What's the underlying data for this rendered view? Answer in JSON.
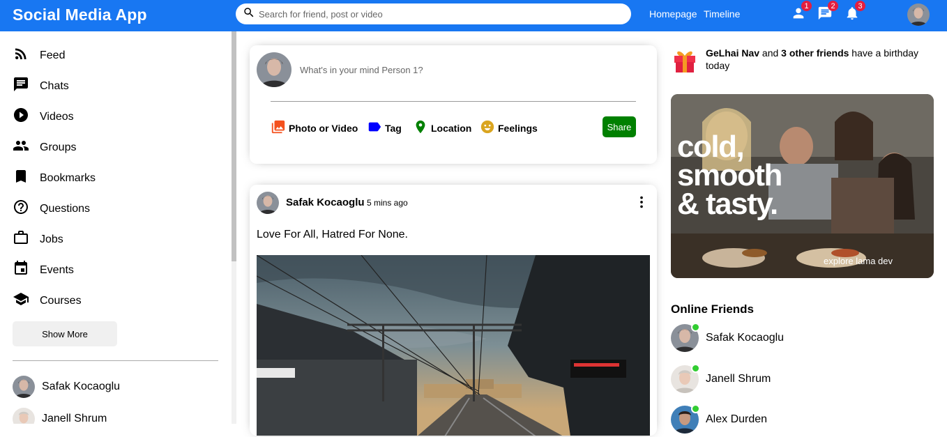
{
  "topbar": {
    "logo": "Social Media App",
    "search_placeholder": "Search for friend, post or video",
    "links": [
      "Homepage",
      "Timeline"
    ],
    "badges": {
      "person": "1",
      "chat": "2",
      "notifications": "3"
    },
    "color": "#1877f2"
  },
  "sidebar": {
    "items": [
      {
        "label": "Feed",
        "icon": "rss-feed-icon"
      },
      {
        "label": "Chats",
        "icon": "chat-icon"
      },
      {
        "label": "Videos",
        "icon": "play-circle-icon"
      },
      {
        "label": "Groups",
        "icon": "group-icon"
      },
      {
        "label": "Bookmarks",
        "icon": "bookmark-icon"
      },
      {
        "label": "Questions",
        "icon": "help-circle-icon"
      },
      {
        "label": "Jobs",
        "icon": "briefcase-icon"
      },
      {
        "label": "Events",
        "icon": "calendar-icon"
      },
      {
        "label": "Courses",
        "icon": "school-icon"
      }
    ],
    "show_more": "Show More",
    "friends": [
      "Safak Kocaoglu",
      "Janell Shrum"
    ]
  },
  "share": {
    "placeholder": "What's in your mind Person 1?",
    "options": [
      {
        "label": "Photo or Video",
        "icon": "photo-library-icon",
        "color": "#f4511e"
      },
      {
        "label": "Tag",
        "icon": "label-icon",
        "color": "#0000ff"
      },
      {
        "label": "Location",
        "icon": "location-pin-icon",
        "color": "#008000"
      },
      {
        "label": "Feelings",
        "icon": "emoji-icon",
        "color": "#daa520"
      }
    ],
    "button": "Share",
    "button_color": "#008000"
  },
  "post": {
    "username": "Safak Kocaoglu",
    "date": "5 mins ago",
    "text": "Love For All, Hatred For None."
  },
  "rightbar": {
    "birthday": {
      "name": "GeLhai Nav",
      "mid": " and ",
      "others": "3 other friends",
      "suffix": " have a birthday today"
    },
    "ad": {
      "line1": "cold,",
      "line2": "smooth",
      "line3": "& tasty.",
      "sub": "explore lama dev"
    },
    "online_title": "Online Friends",
    "online": [
      "Safak Kocaoglu",
      "Janell Shrum",
      "Alex Durden"
    ],
    "online_color": "#32cd32"
  }
}
